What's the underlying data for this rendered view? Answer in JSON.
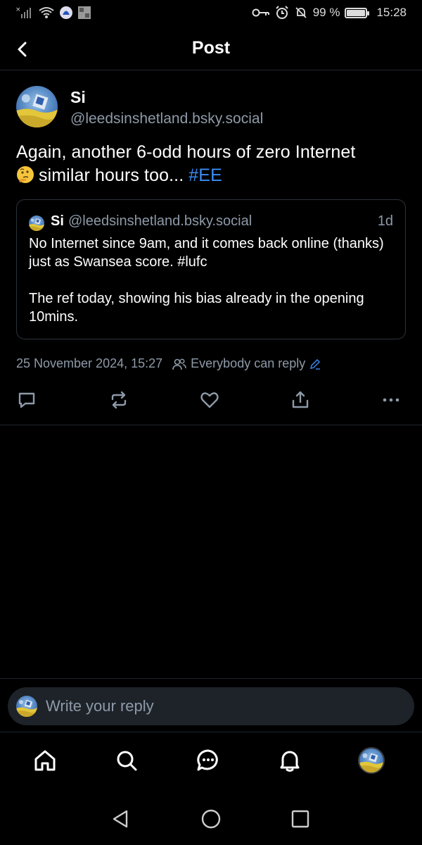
{
  "status_bar": {
    "battery": "99 %",
    "battery_level": 0.99,
    "time": "15:28"
  },
  "header": {
    "title": "Post"
  },
  "post": {
    "author_name": "Si",
    "author_handle": "@leedsinshetland.bsky.social",
    "text": "Again, another 6-odd hours of zero Internet",
    "text_line2": "similar hours too...",
    "hashtag": "#EE",
    "quote": {
      "name": "Si",
      "handle": "@leedsinshetland.bsky.social",
      "time": "1d",
      "paragraph1": "No Internet since 9am, and it comes back online (thanks) just as Swansea score. #lufc",
      "paragraph2": "The ref today, showing his bias already in the opening 10mins."
    },
    "timestamp": "25 November 2024, 15:27",
    "reply_setting": "Everybody can reply"
  },
  "reply": {
    "placeholder": "Write your reply"
  },
  "colors": {
    "background": "#000000",
    "accent": "#3b8cf6",
    "muted": "#8e9aa8",
    "input_bg": "#1e2329"
  }
}
